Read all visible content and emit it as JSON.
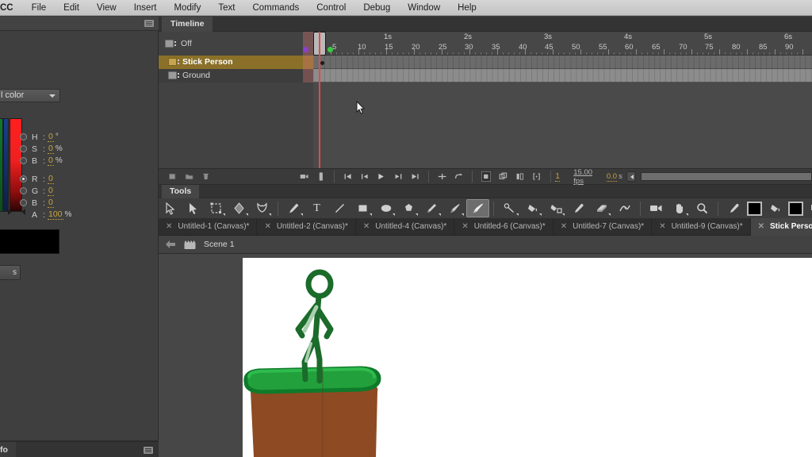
{
  "menubar": {
    "brand": "CC",
    "items": [
      "File",
      "Edit",
      "View",
      "Insert",
      "Modify",
      "Text",
      "Commands",
      "Control",
      "Debug",
      "Window",
      "Help"
    ]
  },
  "color_panel": {
    "mode_label": "l color",
    "fields": [
      {
        "name": "H",
        "value": "0",
        "unit": "°",
        "selected": false
      },
      {
        "name": "S",
        "value": "0",
        "unit": "%",
        "selected": false
      },
      {
        "name": "B",
        "value": "0",
        "unit": "%",
        "selected": false
      },
      {
        "name": "R",
        "value": "0",
        "unit": "",
        "selected": true
      },
      {
        "name": "G",
        "value": "0",
        "unit": "",
        "selected": false
      },
      {
        "name": "B",
        "value": "0",
        "unit": "",
        "selected": false
      },
      {
        "name": "A",
        "value": "100",
        "unit": "%",
        "selected": null
      }
    ],
    "swatch_hex": "#000000",
    "button_label": "s"
  },
  "info_panel": {
    "tab_label": "fo"
  },
  "timeline": {
    "tab_label": "Timeline",
    "header_row_label": "Off",
    "layers": [
      {
        "name": "Stick Person",
        "selected": true,
        "chip_color": "#2ee8c8"
      },
      {
        "name": "Ground",
        "selected": false,
        "chip_color": "#a93fd8"
      }
    ],
    "ruler": {
      "second_labels": [
        "1s",
        "2s",
        "3s",
        "4s",
        "5s",
        "6s"
      ],
      "frame_labels": [
        "5",
        "10",
        "15",
        "20",
        "25",
        "30",
        "35",
        "40",
        "45",
        "50",
        "55",
        "60",
        "65",
        "70",
        "75",
        "80",
        "85",
        "90"
      ]
    },
    "playhead_frame": 1,
    "footer": {
      "current_frame": "1",
      "fps": "15.00 fps",
      "elapsed": "0.0",
      "elapsed_unit": "s"
    }
  },
  "tools": {
    "tab_label": "Tools",
    "items": [
      "selection-tool",
      "subselection-tool",
      "free-transform-tool",
      "gradient-transform-tool",
      "lasso-tool",
      "pen-tool",
      "text-tool",
      "line-tool",
      "rectangle-tool",
      "oval-tool",
      "polystar-tool",
      "pencil-tool",
      "paint-brush-tool",
      "brush-tool",
      "bone-tool",
      "paint-bucket-tool",
      "ink-bottle-tool",
      "eyedropper-tool",
      "eraser-tool",
      "width-tool",
      "camera-tool",
      "hand-tool",
      "zoom-tool",
      "stroke-color-picker",
      "stroke-color-swatch",
      "fill-color-bucket",
      "fill-color-swatch",
      "black-white-button",
      "swap-colors-button"
    ],
    "active_tool": "brush-tool",
    "stroke_color": "#000000",
    "fill_color": "#000000"
  },
  "document_tabs": [
    {
      "label": "Untitled-1 (Canvas)*",
      "active": false
    },
    {
      "label": "Untitled-2 (Canvas)*",
      "active": false
    },
    {
      "label": "Untitled-4 (Canvas)*",
      "active": false
    },
    {
      "label": "Untitled-6 (Canvas)*",
      "active": false
    },
    {
      "label": "Untitled-7 (Canvas)*",
      "active": false
    },
    {
      "label": "Untitled-9 (Canvas)*",
      "active": false
    },
    {
      "label": "Stick Person Start.fla (C",
      "active": true
    }
  ],
  "scene_bar": {
    "scene_name": "Scene 1"
  },
  "canvas": {
    "background": "#ffffff",
    "figure_color": "#1b6b2a",
    "grass_color": "#22a03c",
    "grass_shadow": "#0f7a2a",
    "dirt_color": "#8d4a23"
  }
}
